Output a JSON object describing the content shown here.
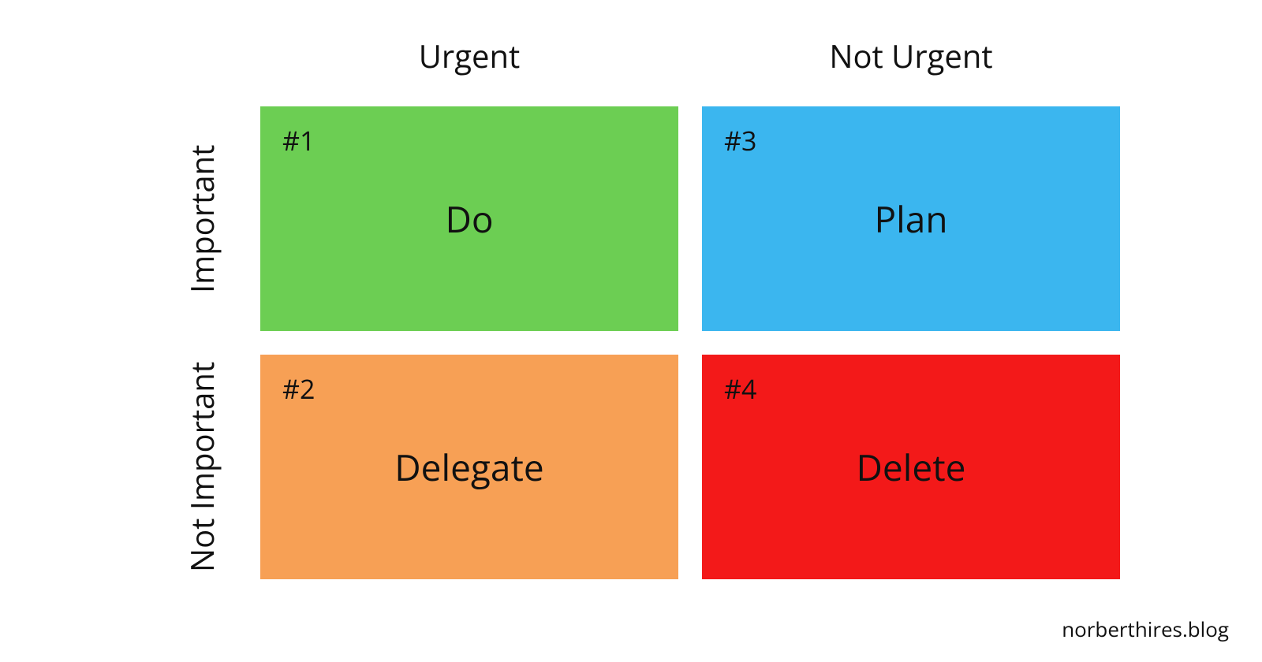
{
  "columns": {
    "left": "Urgent",
    "right": "Not Urgent"
  },
  "rows": {
    "top": "Important",
    "bottom": "Not Important"
  },
  "quadrants": {
    "do": {
      "badge": "#1",
      "label": "Do"
    },
    "plan": {
      "badge": "#3",
      "label": "Plan"
    },
    "delegate": {
      "badge": "#2",
      "label": "Delegate"
    },
    "delete": {
      "badge": "#4",
      "label": "Delete"
    }
  },
  "attribution": "norberthires.blog",
  "colors": {
    "do": "#6cce53",
    "plan": "#3bb6ef",
    "delegate": "#f7a055",
    "delete": "#f31919"
  }
}
